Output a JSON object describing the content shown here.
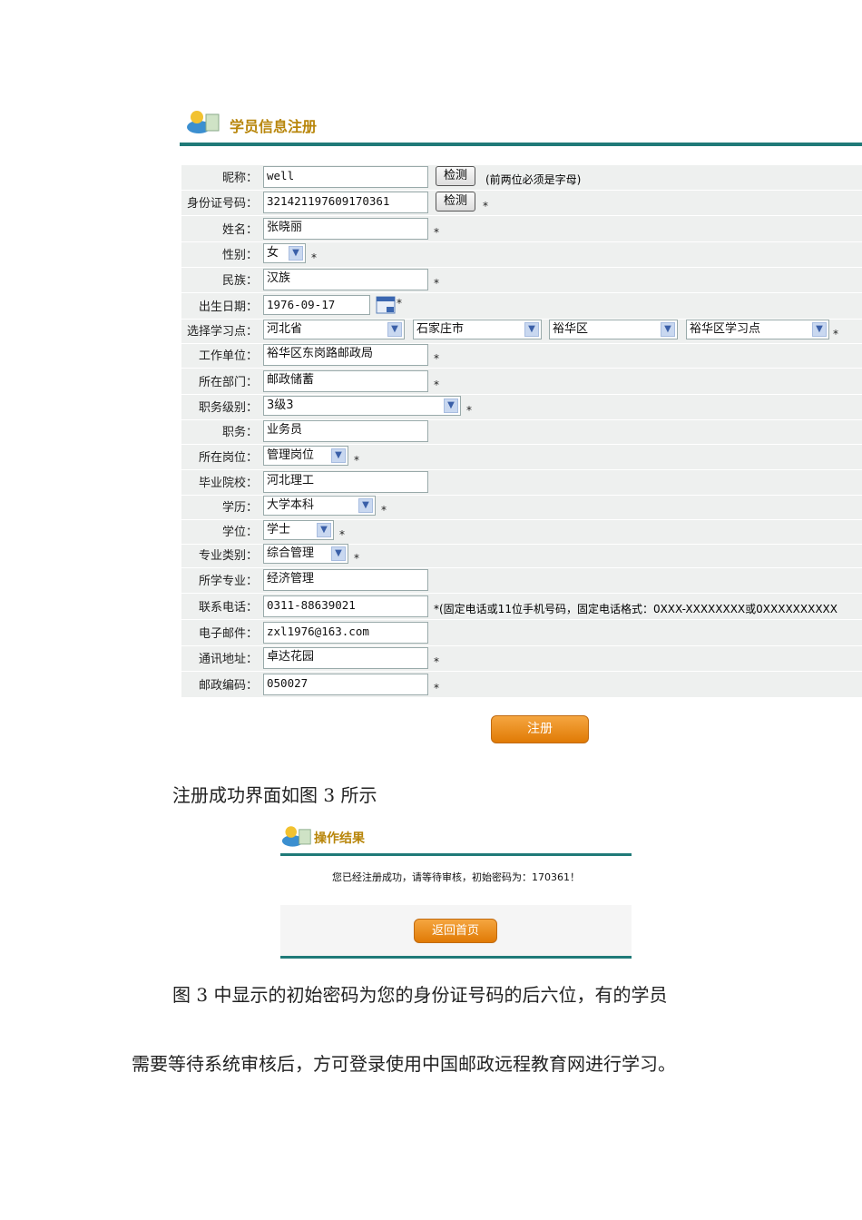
{
  "registration": {
    "title": "学员信息注册",
    "check_label": "检测",
    "nickname_hint": "(前两位必须是字母)",
    "phone_hint": "*(固定电话或11位手机号码，固定电话格式：0XXX-XXXXXXXX或0XXXXXXXXXX",
    "submit_label": "注册",
    "fields": [
      {
        "label": "昵称：",
        "value": "well"
      },
      {
        "label": "身份证号码：",
        "value": "321421197609170361"
      },
      {
        "label": "姓名：",
        "value": "张晓丽"
      },
      {
        "label": "性别：",
        "value": "女"
      },
      {
        "label": "民族：",
        "value": "汉族"
      },
      {
        "label": "出生日期：",
        "value": "1976-09-17"
      },
      {
        "label": "选择学习点：",
        "values": [
          "河北省",
          "石家庄市",
          "裕华区",
          "裕华区学习点"
        ]
      },
      {
        "label": "工作单位：",
        "value": "裕华区东岗路邮政局"
      },
      {
        "label": "所在部门：",
        "value": "邮政储蓄"
      },
      {
        "label": "职务级别：",
        "value": "3级3"
      },
      {
        "label": "职务：",
        "value": "业务员"
      },
      {
        "label": "所在岗位：",
        "value": "管理岗位"
      },
      {
        "label": "毕业院校：",
        "value": "河北理工"
      },
      {
        "label": "学历：",
        "value": "大学本科"
      },
      {
        "label": "学位：",
        "value": "学士"
      },
      {
        "label": "专业类别：",
        "value": "综合管理"
      },
      {
        "label": "所学专业：",
        "value": "经济管理"
      },
      {
        "label": "联系电话：",
        "value": "0311-88639021"
      },
      {
        "label": "电子邮件：",
        "value": "zxl1976@163.com"
      },
      {
        "label": "通讯地址：",
        "value": "卓达花园"
      },
      {
        "label": "邮政编码：",
        "value": "050027"
      }
    ]
  },
  "caption1": "注册成功界面如图 3 所示",
  "result": {
    "title": "操作结果",
    "message": "您已经注册成功，请等待审核，初始密码为：170361！",
    "back_label": "返回首页"
  },
  "para_line1": "图 3 中显示的初始密码为您的身份证号码的后六位，有的学员",
  "para_line2": "需要等待系统审核后，方可登录使用中国邮政远程教育网进行学习。",
  "colors": {
    "accent": "#1f7a78",
    "button": "#e98b15",
    "title": "#b8860b"
  }
}
